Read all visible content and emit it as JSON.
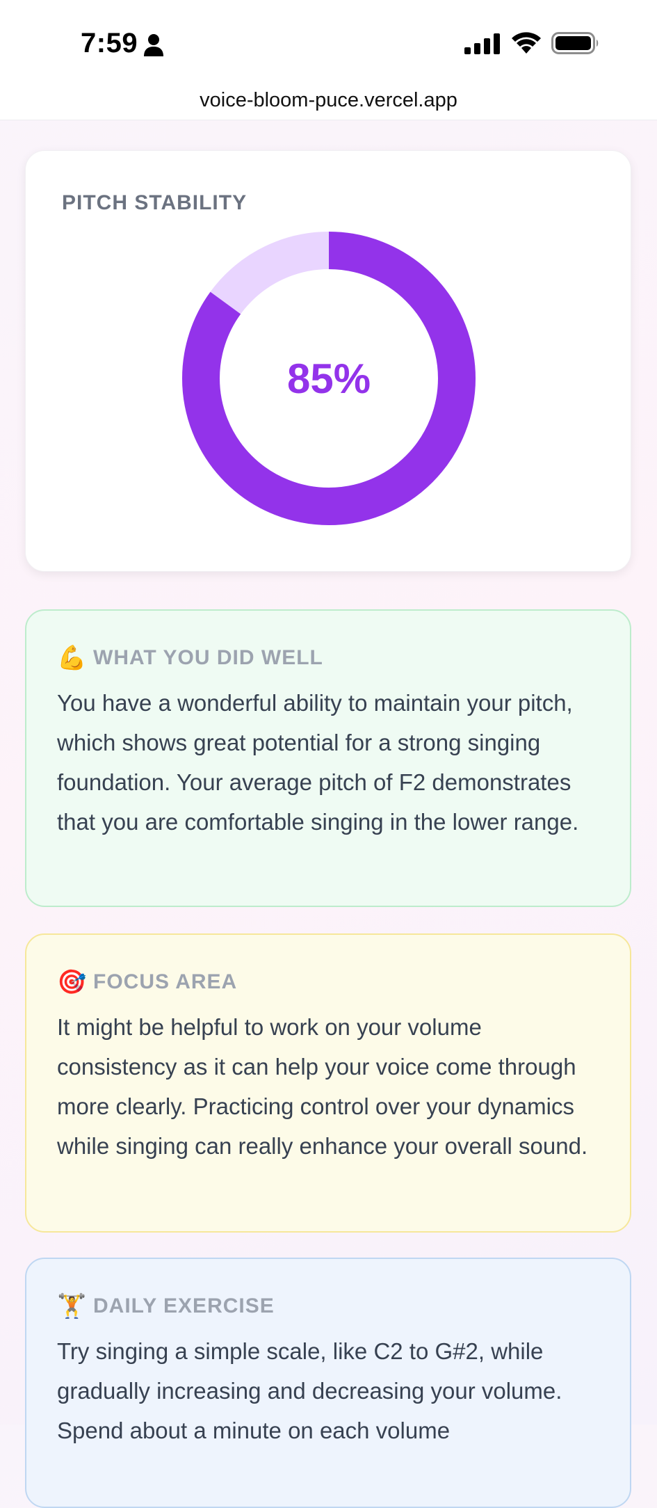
{
  "status_bar": {
    "time": "7:59"
  },
  "browser": {
    "url": "voice-bloom-puce.vercel.app"
  },
  "pitch_stability": {
    "title": "PITCH STABILITY",
    "value_label": "85%",
    "value_fraction": 0.85,
    "colors": {
      "filled": "#9333ea",
      "remaining": "#e9d5ff"
    }
  },
  "cards": [
    {
      "emoji": "💪",
      "label": "WHAT YOU DID WELL",
      "body": "You have a wonderful ability to maintain your pitch, which shows great potential for a strong singing foundation. Your average pitch of F2 demonstrates that you are comfortable singing in the lower range."
    },
    {
      "emoji": "🎯",
      "label": "FOCUS AREA",
      "body": "It might be helpful to work on your volume consistency as it can help your voice come through more clearly. Practicing control over your dynamics while singing can really enhance your overall sound."
    },
    {
      "emoji": "🏋️",
      "label": "DAILY EXERCISE",
      "body": "Try singing a simple scale, like C2 to G#2, while gradually increasing and decreasing your volume. Spend about a minute on each volume"
    }
  ]
}
